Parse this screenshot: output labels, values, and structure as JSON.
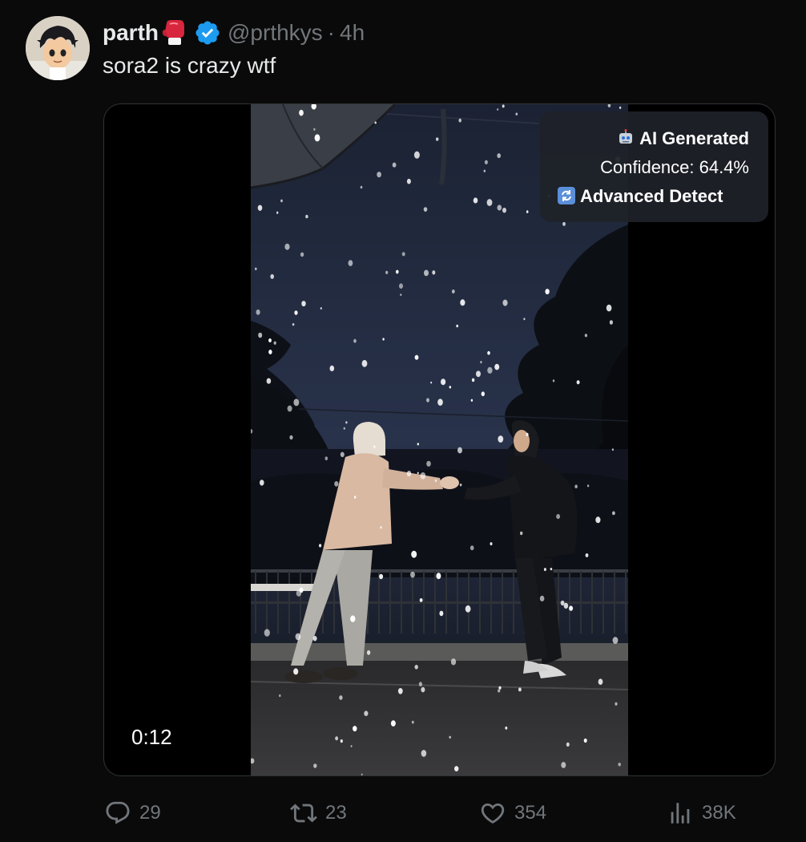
{
  "post": {
    "display_name": "parth",
    "name_emoji": "boxing-glove-icon",
    "verified_icon": "verified-badge-icon",
    "handle": "@prthkys",
    "separator": "·",
    "time": "4h",
    "text": "sora2 is crazy wtf"
  },
  "media": {
    "duration": "0:12",
    "ai_badge": {
      "label": "AI Generated",
      "label_icon": "robot-icon",
      "confidence": "Confidence: 64.4%",
      "detect_label": "Advanced Detect",
      "detect_icon": "refresh-icon"
    }
  },
  "actions": {
    "replies": "29",
    "reposts": "23",
    "likes": "354",
    "views": "38K"
  },
  "colors": {
    "background": "#0a0a0a",
    "text": "#e7e9ea",
    "muted": "#71767b",
    "verified": "#1d9bf0",
    "border": "#2f3336"
  }
}
